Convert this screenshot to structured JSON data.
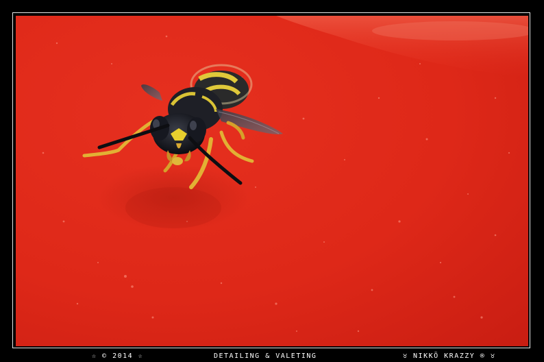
{
  "photo": {
    "subject_icon": "wasp",
    "background_color": "#e02a1c"
  },
  "watermark": {
    "left": "☆ © 2014 ☆",
    "center": "DETAILING & VALETING",
    "right": "♉ NIKKÖ KRAZZY ® ♉"
  },
  "colors": {
    "frame": "#000000",
    "frame_line": "#e8e8e8",
    "text": "#ffffff"
  }
}
